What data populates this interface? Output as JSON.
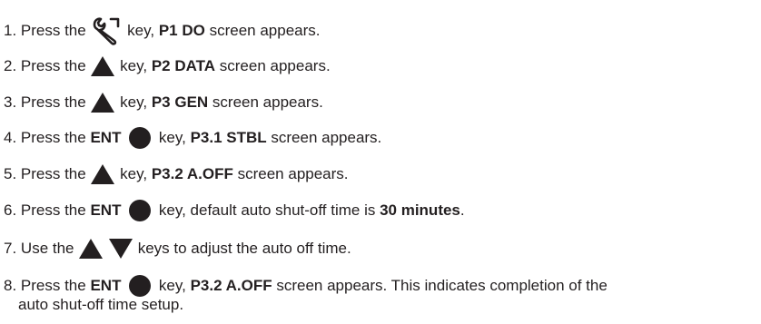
{
  "steps": [
    {
      "num": "1.",
      "pre": " Press the ",
      "key_icon": "wrench-icon",
      "post": " key, ",
      "bold": "P1 DO",
      "tail": " screen appears."
    },
    {
      "num": "2.",
      "pre": " Press the ",
      "key_icon": "triangle-up-icon",
      "post": " key, ",
      "bold": "P2 DATA",
      "tail": " screen appears."
    },
    {
      "num": "3.",
      "pre": " Press the ",
      "key_icon": "triangle-up-icon",
      "post": " key, ",
      "bold": "P3 GEN",
      "tail": " screen appears."
    },
    {
      "num": "4.",
      "pre": " Press the ",
      "key_label": "ENT",
      "key_icon": "circle-icon",
      "post": " key, ",
      "bold": "P3.1 STBL",
      "tail": " screen appears."
    },
    {
      "num": "5.",
      "pre": " Press the ",
      "key_icon": "triangle-up-icon",
      "post": " key, ",
      "bold": "P3.2 A.OFF",
      "tail": " screen appears."
    },
    {
      "num": "6.",
      "pre": " Press the ",
      "key_label": "ENT",
      "key_icon": "circle-icon",
      "post": " key, default auto shut-off time is ",
      "bold": "30 minutes",
      "tail": "."
    },
    {
      "num": "7.",
      "pre": " Use the ",
      "key_icons": [
        "triangle-up-icon",
        "triangle-down-icon"
      ],
      "post": " keys to adjust the auto off time."
    },
    {
      "num": "8.",
      "pre": " Press the ",
      "key_label": "ENT",
      "key_icon": "circle-icon",
      "post": " key, ",
      "bold": "P3.2 A.OFF",
      "tail": " screen appears. This indicates completion of the",
      "continuation": "auto shut-off time setup."
    }
  ]
}
